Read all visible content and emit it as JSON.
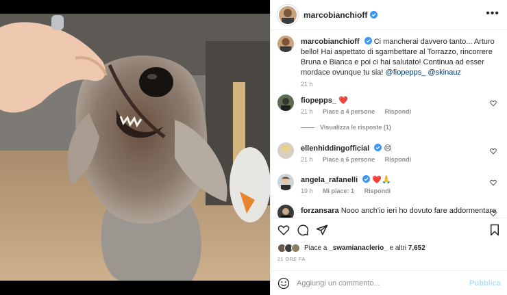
{
  "post": {
    "author": "marcobianchioff",
    "more_icon": "more-options-icon"
  },
  "caption": {
    "username": "marcobianchioff",
    "text": "Ci mancherai davvero tanto... Arturo bello! Hai aspettato di sgambettare al Torrazzo, rincorrere Bruna e Bianca e poi ci hai salutato! Continua ad esser mordace ovunque tu sia!",
    "mention1": "@fiopepps_",
    "mention2": "@skinauz",
    "time": "21 h"
  },
  "comments": [
    {
      "username": "fiopepps_",
      "text": "❤️",
      "time": "21 h",
      "likes": "Piace a 4 persone",
      "reply": "Rispondi"
    },
    {
      "username": "ellenhiddingofficial",
      "text": "😔",
      "time": "21 h",
      "likes": "Piace a 6 persone",
      "reply": "Rispondi"
    },
    {
      "username": "angela_rafanelli",
      "text": "❤️🙏",
      "time": "19 h",
      "likes": "Mi piace: 1",
      "reply": "Rispondi"
    },
    {
      "username": "forzansara",
      "text": "Nooo anch'io ieri ho dovuto fare addormentare",
      "time": "",
      "likes": "",
      "reply": ""
    }
  ],
  "replies_link": "Visualizza le risposte (1)",
  "likes_line": {
    "prefix": "Piace a",
    "user": "_swamianaclerio_",
    "suffix": "e altri",
    "count": "7,652"
  },
  "timestamp": "21 ORE FA",
  "composer": {
    "placeholder": "Aggiungi un commento...",
    "publish": "Pubblica"
  },
  "colors": {
    "verified": "#3897f0",
    "publish_disabled": "#b2dffc",
    "heart_red": "#ed4956"
  }
}
